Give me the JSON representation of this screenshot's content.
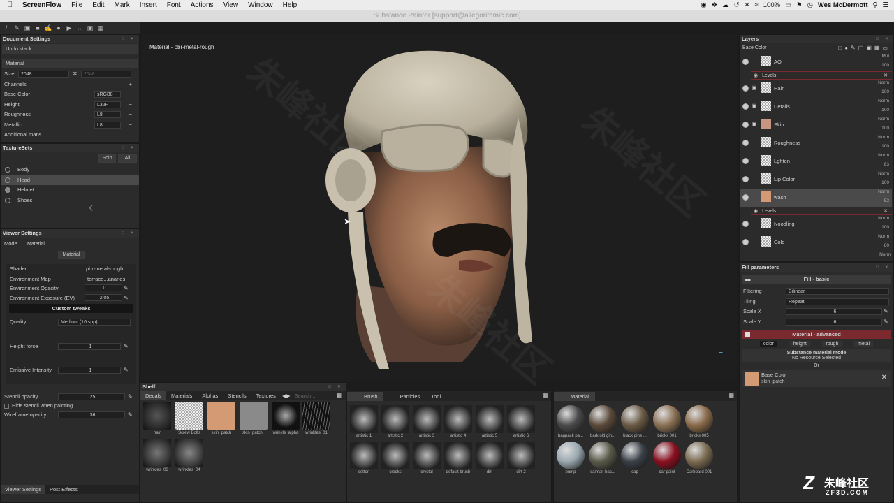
{
  "menubar": {
    "app": "ScreenFlow",
    "items": [
      "File",
      "Edit",
      "Mark",
      "Insert",
      "Font",
      "Actions",
      "View",
      "Window",
      "Help"
    ],
    "battery": "100%",
    "user": "Wes McDermott"
  },
  "titlebar": {
    "title": "Substance Painter [support@allegorithmic.com]"
  },
  "document_settings": {
    "header": "Document Settings",
    "undo_stack": "Undo stack",
    "material": "Material",
    "size_label": "Size",
    "size_value": "2048",
    "size_value2": "2048",
    "channels_label": "Channels",
    "channels": [
      {
        "name": "Base Color",
        "format": "sRGB8"
      },
      {
        "name": "Height",
        "format": "L32F"
      },
      {
        "name": "Roughness",
        "format": "L8"
      },
      {
        "name": "Metallic",
        "format": "L8"
      }
    ],
    "additional_maps": "Additional maps"
  },
  "texture_sets": {
    "header": "TextureSets",
    "solo": "Solo",
    "all": "All",
    "items": [
      "Body",
      "Head",
      "Helmet",
      "Shoes"
    ],
    "selected": "Head"
  },
  "viewer_settings": {
    "header": "Viewer Settings",
    "mode_label": "Mode",
    "mode_value": "Material",
    "material_button": "Material",
    "shader_label": "Shader",
    "shader_value": "pbr-metal-rough",
    "env_map_label": "Environment Map",
    "env_map_value": "terrace...anaries",
    "env_opacity_label": "Environment Opacity",
    "env_opacity_value": "0",
    "env_exposure_label": "Environment Exposure (EV)",
    "env_exposure_value": "2.05",
    "custom_tweaks": "Custom tweaks",
    "quality_label": "Quality",
    "quality_value": "Medium (16 spp)",
    "height_force_label": "Height force",
    "height_force_value": "1",
    "emissive_label": "Emissive Intensity",
    "emissive_value": "1",
    "stencil_opacity_label": "Stencil opacity",
    "stencil_opacity_value": "25",
    "hide_stencil_label": "Hide stencil when painting",
    "wireframe_label": "Wireframe opacity",
    "wireframe_value": "36",
    "tab1": "Viewer Settings",
    "tab2": "Post Effects"
  },
  "viewport": {
    "label": "Material - pbr-metal-rough"
  },
  "shelf": {
    "header": "Shelf",
    "tabs": [
      "Decals",
      "Materials",
      "Alphas",
      "Stencils",
      "Textures"
    ],
    "search_placeholder": "Search...",
    "decals": [
      "hair",
      "Screw Bolts",
      "skin_patch",
      "skin_patch_",
      "wrinkle_alpha",
      "wrinkles_01",
      "wrinkles_03",
      "wrinkles_04"
    ],
    "brush_tabs": [
      "Brush",
      "Particles",
      "Tool"
    ],
    "brushes": [
      "artistic 1",
      "artistic 2",
      "artistic 3",
      "artistic 4",
      "artistic 5",
      "artistic 6",
      "cotton",
      "cracks",
      "crystal",
      "default brush",
      "dirt",
      "dirt 2"
    ],
    "material_tab": "Material",
    "materials": [
      "bagpack pa...",
      "bark old gin...",
      "black pine ...",
      "bricks 001",
      "bricks 005",
      "bump",
      "caiman bac...",
      "cap",
      "car paint",
      "Carboard 001"
    ]
  },
  "layers": {
    "header": "Layers",
    "channel": "Base Color",
    "items": [
      {
        "name": "AO",
        "blend": "Mul",
        "opacity": "100"
      },
      {
        "name": "Hair",
        "blend": "Norm",
        "opacity": "100"
      },
      {
        "name": "Details",
        "blend": "Norm",
        "opacity": "100"
      },
      {
        "name": "Skin",
        "blend": "Norm",
        "opacity": "100"
      },
      {
        "name": "Roughness",
        "blend": "Norm",
        "opacity": "100"
      },
      {
        "name": "Lghten",
        "blend": "Norm",
        "opacity": "83"
      },
      {
        "name": "Lip Color",
        "blend": "Norm",
        "opacity": "100"
      },
      {
        "name": "wash",
        "blend": "Norm",
        "opacity": "52"
      },
      {
        "name": "Noodling",
        "blend": "Norm",
        "opacity": "100"
      },
      {
        "name": "Cold",
        "blend": "Norm",
        "opacity": "80"
      }
    ],
    "effect": "Levels",
    "trailing_blend": "Norm"
  },
  "fill_params": {
    "header": "Fill parameters",
    "section": "Fill - basic",
    "filtering_label": "Filtering",
    "filtering_value": "Bilinear",
    "tiling_label": "Tiling",
    "tiling_value": "Repeat",
    "scale_x_label": "Scale X",
    "scale_x_value": "6",
    "scale_y_label": "Scale Y",
    "scale_y_value": "6",
    "advanced": "Material - advanced",
    "channels": [
      "color",
      "height",
      "rough",
      "metal"
    ],
    "mode_title": "Substance material mode",
    "mode_status": "No Resource Selected",
    "or": "Or",
    "base_color_label": "Base Color",
    "base_color_resource": "skin_patch"
  },
  "watermark": {
    "brand": "朱峰社区",
    "url": "ZF3D.COM"
  },
  "colors": {
    "accent_red": "#7a2a2f",
    "skin": "#d39a74",
    "selected_row": "#4a4a4a"
  }
}
